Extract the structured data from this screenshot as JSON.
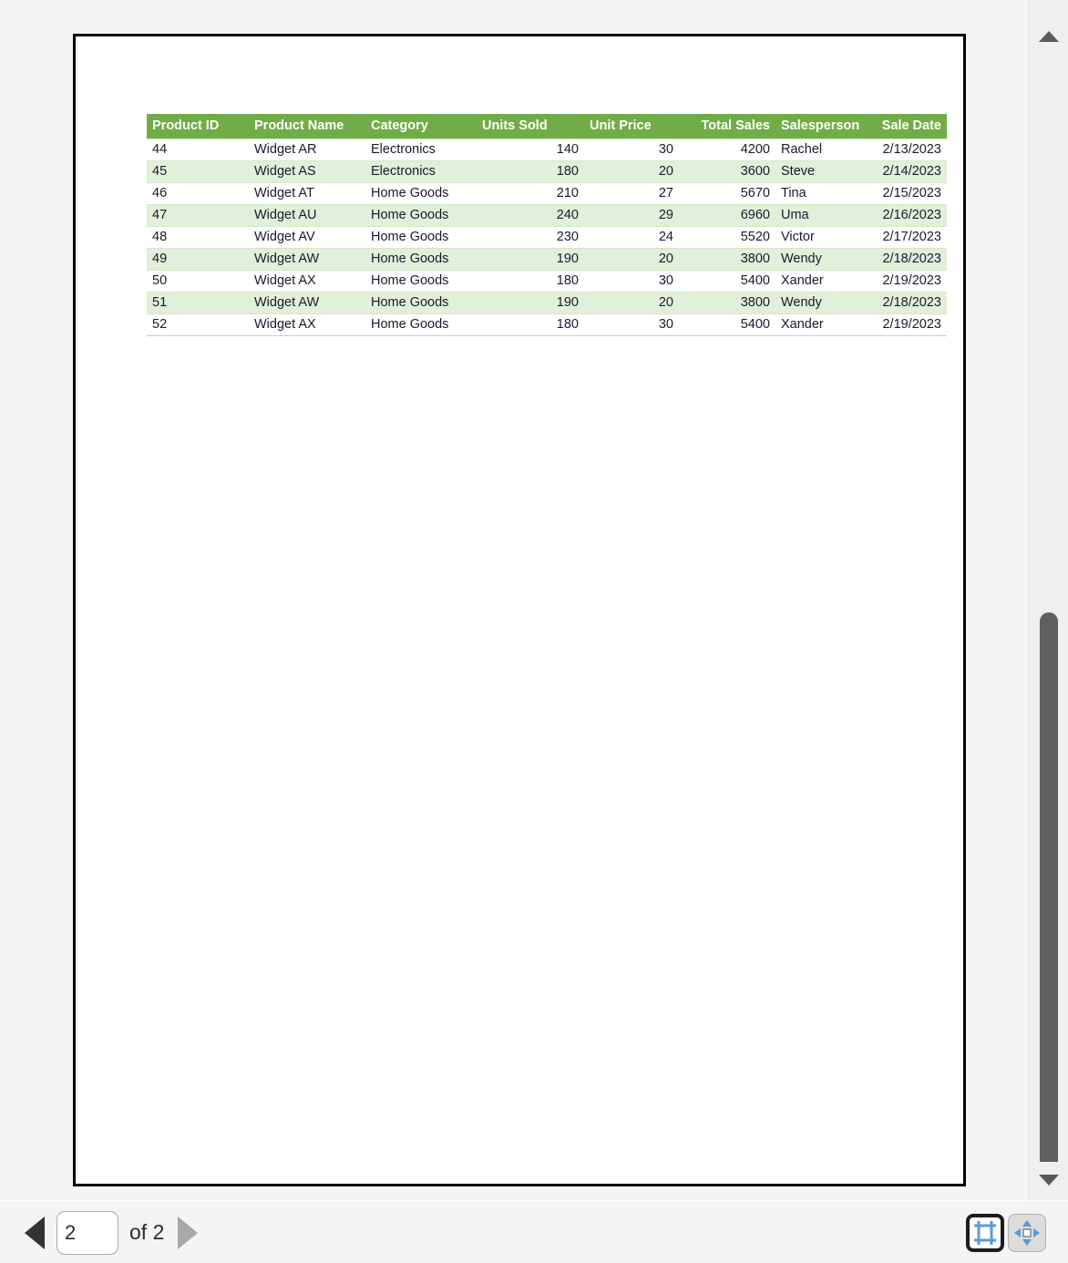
{
  "window": {
    "background_color": "#f5f5f5",
    "page_background": "#ffffff",
    "page_border_color": "#000000"
  },
  "table": {
    "header_bg": "#70ad47",
    "header_text_color": "#ffffff",
    "band_color": "#e2efda",
    "columns": [
      "Product ID",
      "Product Name",
      "Category",
      "Units Sold",
      "Unit Price",
      "Total Sales",
      "Salesperson",
      "Sale Date"
    ],
    "rows": [
      [
        "44",
        "Widget AR",
        "Electronics",
        "140",
        "30",
        "4200",
        "Rachel",
        "2/13/2023"
      ],
      [
        "45",
        "Widget AS",
        "Electronics",
        "180",
        "20",
        "3600",
        "Steve",
        "2/14/2023"
      ],
      [
        "46",
        "Widget AT",
        "Home Goods",
        "210",
        "27",
        "5670",
        "Tina",
        "2/15/2023"
      ],
      [
        "47",
        "Widget AU",
        "Home Goods",
        "240",
        "29",
        "6960",
        "Uma",
        "2/16/2023"
      ],
      [
        "48",
        "Widget AV",
        "Home Goods",
        "230",
        "24",
        "5520",
        "Victor",
        "2/17/2023"
      ],
      [
        "49",
        "Widget AW",
        "Home Goods",
        "190",
        "20",
        "3800",
        "Wendy",
        "2/18/2023"
      ],
      [
        "50",
        "Widget AX",
        "Home Goods",
        "180",
        "30",
        "5400",
        "Xander",
        "2/19/2023"
      ],
      [
        "51",
        "Widget AW",
        "Home Goods",
        "190",
        "20",
        "3800",
        "Wendy",
        "2/18/2023"
      ],
      [
        "52",
        "Widget AX",
        "Home Goods",
        "180",
        "30",
        "5400",
        "Xander",
        "2/19/2023"
      ]
    ]
  },
  "scrollbar": {
    "up_arrow_icon": "triangle-up-icon",
    "down_arrow_icon": "triangle-down-icon",
    "thumb_color": "#5f5f5f"
  },
  "toolbar": {
    "prev_page_icon": "triangle-left-icon",
    "next_page_icon": "triangle-right-icon",
    "page_value": "2",
    "page_placeholder": "1",
    "page_total_label": "of 2",
    "view_layout_icon": "page-layout-icon",
    "view_pan_icon": "pan-move-icon"
  }
}
